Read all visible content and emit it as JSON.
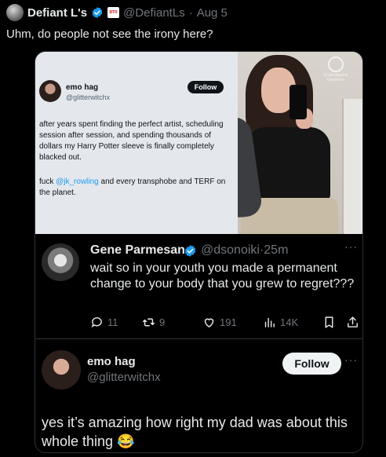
{
  "post": {
    "author_name": "Defiant L's",
    "handle": "@DefiantLs",
    "separator": "·",
    "date": "Aug 5",
    "text": "Uhm, do people not see the irony here?",
    "affiliate_badge": "BTR"
  },
  "screenshot_card": {
    "name": "emo hag",
    "handle": "@glitterwitchx",
    "follow_label": "Follow",
    "text_1": "after years spent finding the perfect artist, scheduling session after session, and spending thousands of dollars my Harry Potter sleeve is finally completely blacked out.",
    "text_2_prefix": "fuck ",
    "text_2_mention": "@jk_rowling",
    "text_2_suffix": " and every transphobe and TERF on the planet."
  },
  "photo": {
    "watermark_1": "Grass Against",
    "watermark_2": "Groomers"
  },
  "reply": {
    "name": "Gene Parmesan",
    "handle": "@dsonoiki",
    "separator": "·",
    "time": "25m",
    "text": "wait so in your youth you made a permanent change to your body that you grew to regret???",
    "more": "···",
    "stats": {
      "replies": "11",
      "reposts": "9",
      "likes": "191",
      "views": "14K"
    }
  },
  "post2": {
    "name": "emo hag",
    "handle": "@glitterwitchx",
    "follow_label": "Follow",
    "more": "···",
    "text": "yes it’s amazing how right my dad was about this whole thing 😂"
  },
  "colors": {
    "background": "#000000",
    "text_primary": "#e7e9ea",
    "text_secondary": "#71767b",
    "accent_blue": "#1d9bf0"
  }
}
